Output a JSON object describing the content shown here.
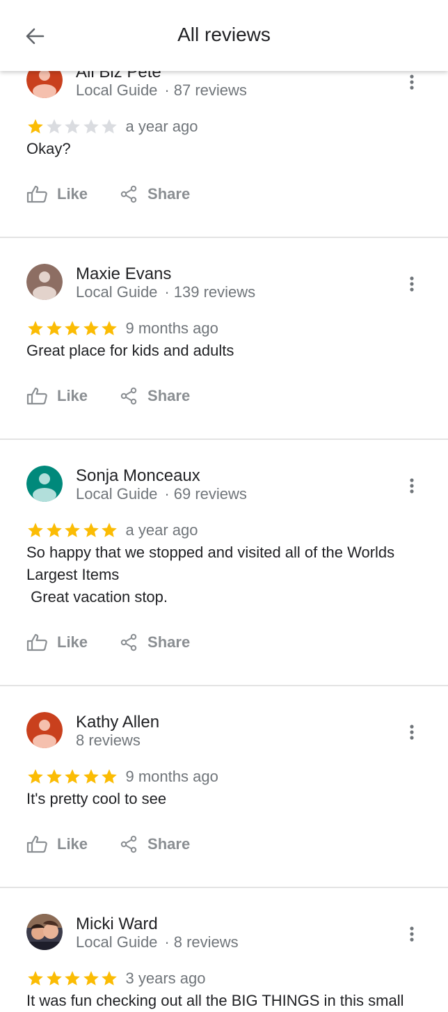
{
  "header": {
    "title": "All reviews"
  },
  "colors": {
    "star_filled": "#fbbc04",
    "star_empty": "#dadce0",
    "secondary_text": "#70757a",
    "action_text": "#8a8e92"
  },
  "reviews": [
    {
      "name": "All Biz Pete",
      "guide": "Local Guide",
      "separator": "·",
      "count": "87 reviews",
      "rating": 1,
      "date": "a year ago",
      "text": "Okay?",
      "avatar_color": "#c9401d",
      "like_label": "Like",
      "share_label": "Share"
    },
    {
      "name": "Maxie Evans",
      "guide": "Local Guide",
      "separator": "·",
      "count": "139 reviews",
      "rating": 5,
      "date": "9 months ago",
      "text": "Great place for kids and adults",
      "avatar_color": "#8d6e63",
      "like_label": "Like",
      "share_label": "Share"
    },
    {
      "name": "Sonja Monceaux",
      "guide": "Local Guide",
      "separator": "·",
      "count": "69 reviews",
      "rating": 5,
      "date": "a year ago",
      "text": "So happy that we stopped and visited all of the Worlds Largest Items\n Great vacation stop.",
      "avatar_color": "#00897b",
      "like_label": "Like",
      "share_label": "Share"
    },
    {
      "name": "Kathy Allen",
      "guide": "",
      "separator": "",
      "count": "8 reviews",
      "rating": 5,
      "date": "9 months ago",
      "text": "It's pretty cool to see",
      "avatar_color": "#c9401d",
      "like_label": "Like",
      "share_label": "Share"
    },
    {
      "name": "Micki Ward",
      "guide": "Local Guide",
      "separator": "·",
      "count": "8 reviews",
      "rating": 5,
      "date": "3 years ago",
      "text": "It was fun checking out all the BIG THINGS in this small",
      "avatar_color": "#3b3b4a",
      "like_label": "Like",
      "share_label": "Share"
    }
  ]
}
